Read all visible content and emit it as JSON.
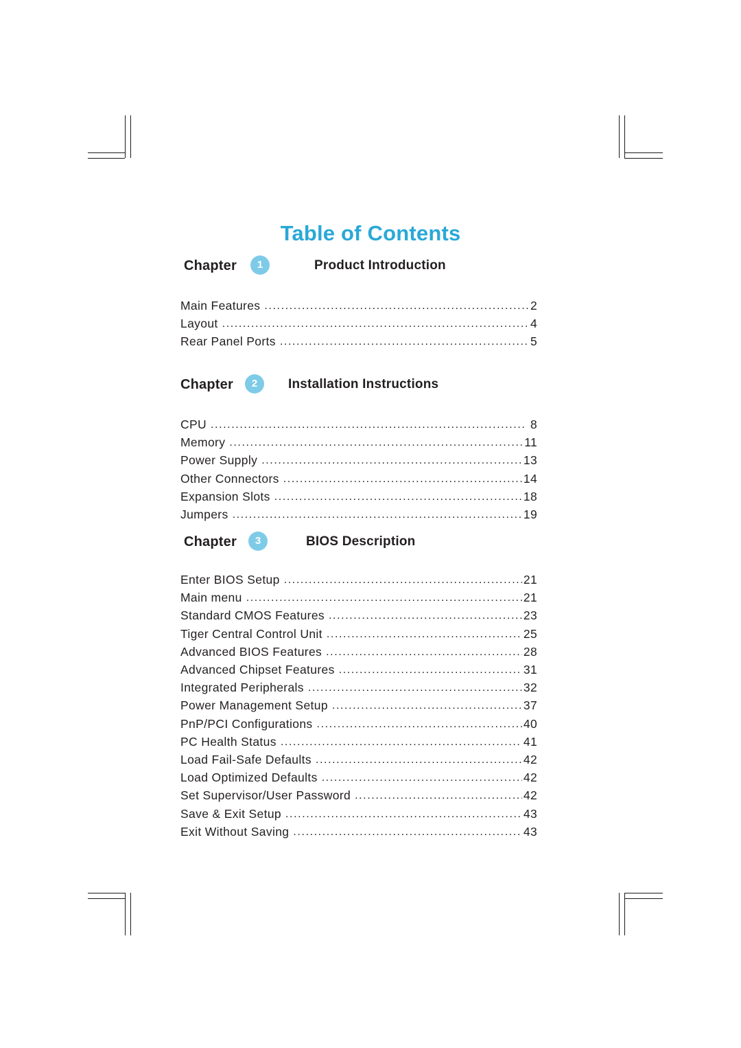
{
  "document": {
    "title": "Table of Contents"
  },
  "chapters": [
    {
      "chapter_word": "Chapter",
      "number": "1",
      "name": "Product Introduction",
      "entries": [
        {
          "label": "Main Features",
          "page": "2"
        },
        {
          "label": "Layout",
          "page": "4"
        },
        {
          "label": "Rear Panel Ports",
          "page": "5"
        }
      ]
    },
    {
      "chapter_word": "Chapter",
      "number": "2",
      "name": "Installation Instructions",
      "entries": [
        {
          "label": "CPU",
          "page": "8"
        },
        {
          "label": "Memory",
          "page": "11"
        },
        {
          "label": "Power Supply",
          "page": "13"
        },
        {
          "label": "Other Connectors",
          "page": "14"
        },
        {
          "label": "Expansion Slots",
          "page": "18"
        },
        {
          "label": "Jumpers",
          "page": "19"
        }
      ]
    },
    {
      "chapter_word": "Chapter",
      "number": "3",
      "name": "BIOS Description",
      "entries": [
        {
          "label": "Enter BIOS Setup",
          "page": "21"
        },
        {
          "label": "Main menu",
          "page": "21"
        },
        {
          "label": "Standard CMOS Features",
          "page": "23"
        },
        {
          "label": "Tiger Central Control Unit",
          "page": "25"
        },
        {
          "label": "Advanced BIOS Features",
          "page": "28"
        },
        {
          "label": "Advanced Chipset Features",
          "page": "31"
        },
        {
          "label": "Integrated Peripherals",
          "page": "32"
        },
        {
          "label": "Power Management Setup",
          "page": "37"
        },
        {
          "label": "PnP/PCI Configurations",
          "page": "40"
        },
        {
          "label": "PC Health Status",
          "page": "41"
        },
        {
          "label": "Load Fail-Safe  Defaults",
          "page": "42"
        },
        {
          "label": "Load  Optimized  Defaults",
          "page": "42"
        },
        {
          "label": "Set Supervisor/User Password",
          "page": "42"
        },
        {
          "label": "Save & Exit Setup",
          "page": "43"
        },
        {
          "label": "Exit Without Saving",
          "page": "43"
        }
      ]
    }
  ],
  "colors": {
    "accent": "#29a8d8",
    "badge": "#7ecbe8",
    "text": "#231f20"
  }
}
